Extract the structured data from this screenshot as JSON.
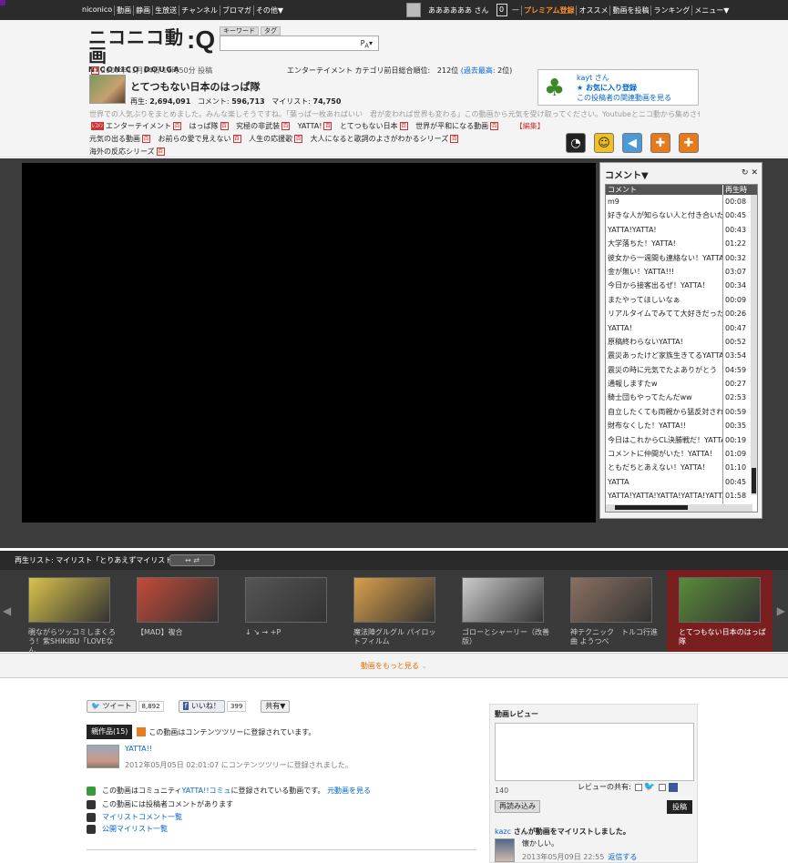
{
  "topbar": {
    "nav": [
      "niconico",
      "動画",
      "静画",
      "生放送",
      "チャンネル",
      "ブロマガ",
      "その他▼"
    ],
    "username": "ああああああ さん",
    "badge": "0",
    "links": [
      "プレミアム登録",
      "オススメ",
      "動画を投稿",
      "ランキング",
      "メニュー▼"
    ]
  },
  "logo": {
    "main": "ニコニコ動画",
    "sub": "NICONICO DOUGA",
    "q": ":Q"
  },
  "search": {
    "tabs": [
      "キーワード",
      "タグ"
    ],
    "placeholder": "",
    "icon": "search-options-icon"
  },
  "video": {
    "post_date": "2007年11月04日 11時50分 投稿",
    "rank_label": "エンターテイメント カテゴリ前日総合順位:",
    "rank_value": "212位",
    "rank_past_label": "(過去最高:",
    "rank_past_value": "2位)",
    "title": "とてつもない日本のはっぱ隊",
    "views_label": "再生:",
    "views": "2,694,091",
    "comments_label": "コメント:",
    "comments": "596,713",
    "mylist_label": "マイリスト:",
    "mylist": "74,750",
    "description": "世界での人気ぶりをまとめました。みんな楽しそうですね。「葉っぱ一枚あればいい　君が変われば世界も変わる」この動画から元気を受け取ってください。Youtubeとニコ動から集めさせて…",
    "tags": [
      "エンターテイメント",
      "はっぱ隊",
      "究極の非武装",
      "YATTA!",
      "とてつもない日本",
      "世界が平和になる動画",
      "元気の出る動画",
      "お前らの愛で見えない",
      "人生の応援歌",
      "大人になると歌詞のよさがわかるシリーズ",
      "海外の反応シリーズ"
    ],
    "tag_edit": "【編集】"
  },
  "uploader": {
    "name": "kayt さん",
    "fav": "★ お気に入り登録",
    "related": "この投稿者の関連動画を見る"
  },
  "comment_panel": {
    "title": "コメント▼",
    "col_comment": "コメント",
    "col_time": "再生時",
    "rows": [
      {
        "text": "m9",
        "time": "00:08"
      },
      {
        "text": "好きな人が知らない人と付き合いだした",
        "time": "00:45"
      },
      {
        "text": "YATTA!YATTA!",
        "time": "00:43"
      },
      {
        "text": "大学落ちた！YATTA!",
        "time": "01:22"
      },
      {
        "text": "彼女から一週間も連絡ない！YATTA!",
        "time": "00:32"
      },
      {
        "text": "金が無い！YATTA!!!",
        "time": "03:07"
      },
      {
        "text": "今日から接客出るぜ！YATTA！",
        "time": "00:34"
      },
      {
        "text": "またやってほしいなぁ",
        "time": "00:09"
      },
      {
        "text": "リアルタイムでみてて大好きだった",
        "time": "00:26"
      },
      {
        "text": "YATTA！",
        "time": "00:47"
      },
      {
        "text": "原稿終わらないYATTA!",
        "time": "00:52"
      },
      {
        "text": "震災あったけど家族生きてるYATTA",
        "time": "03:54"
      },
      {
        "text": "震災の時に元気でたよありがとう",
        "time": "04:59"
      },
      {
        "text": "通報しますたw",
        "time": "00:27"
      },
      {
        "text": "騎士団もやってたんだww",
        "time": "02:53"
      },
      {
        "text": "自立したくても両親から猛反対されるYATTA",
        "time": "00:59"
      },
      {
        "text": "財布なくした！YATTA!!",
        "time": "00:35"
      },
      {
        "text": "今日はこれからCL決勝戦だ！YATTA",
        "time": "00:19"
      },
      {
        "text": "コメントに仲間がいた！YATTA！",
        "time": "01:09"
      },
      {
        "text": "ともだちとあえない！YATTA！",
        "time": "01:10"
      },
      {
        "text": "YATTA",
        "time": "00:45"
      },
      {
        "text": "YATTA!YATTA!YATTA!YATTA!YATTA!",
        "time": "01:58"
      }
    ]
  },
  "playlist": {
    "label": "再生リスト: マイリスト「とりあえずマイリスト」",
    "items": [
      {
        "title": "覗ながらツッコミしまくろう！紫SHIKIBU「LOVEなん",
        "color": "#d9c24a"
      },
      {
        "title": "【MAD】複合",
        "color": "#c44a3a"
      },
      {
        "title": "↓ ↘ → +P",
        "color": "#555"
      },
      {
        "title": "魔法陣グルグル パイロットフィルム",
        "color": "#d9a04a"
      },
      {
        "title": "ゴローとシャーリー（改善版）",
        "color": "#ccc"
      },
      {
        "title": "神テクニック　トルコ行進曲 ようつべ",
        "color": "#8a7060"
      },
      {
        "title": "とてつもない日本のはっぱ隊",
        "color": "#5a8a3a"
      }
    ],
    "more": "動画をもっと見る"
  },
  "social": {
    "tweet": "ツイート",
    "tweet_count": "8,892",
    "like": "いいね！",
    "like_count": "399",
    "share": "共有▼"
  },
  "parent": {
    "tab": "親作品(15)",
    "note": "この動画はコンテンツツリーに登録されています。",
    "item_title": "YATTA!!",
    "item_date": "2012年05月05日 02:01:07 にコンテンツツリーに登録されました。"
  },
  "info": {
    "community_pre": "この動画はコミュニティ",
    "community_link": "YATTA!!コミュ",
    "community_post": "に登録されている動画です。",
    "community_orig": "元動画を見る",
    "uploader_comment": "この動画には投稿者コメントがあります",
    "mylist_comments": "マイリストコメント一覧",
    "public_mylist": "公開マイリスト一覧"
  },
  "review": {
    "title": "動画レビュー",
    "count": "140",
    "share_label": "レビューの共有:",
    "reload": "再読み込み",
    "post": "投稿",
    "activity_user": "kazc",
    "activity_text": " さんが動画をマイリストしました。",
    "entry_text": "懐かしい。",
    "entry_date": "2013年05月09日 22:55",
    "entry_reply": "返信する"
  }
}
